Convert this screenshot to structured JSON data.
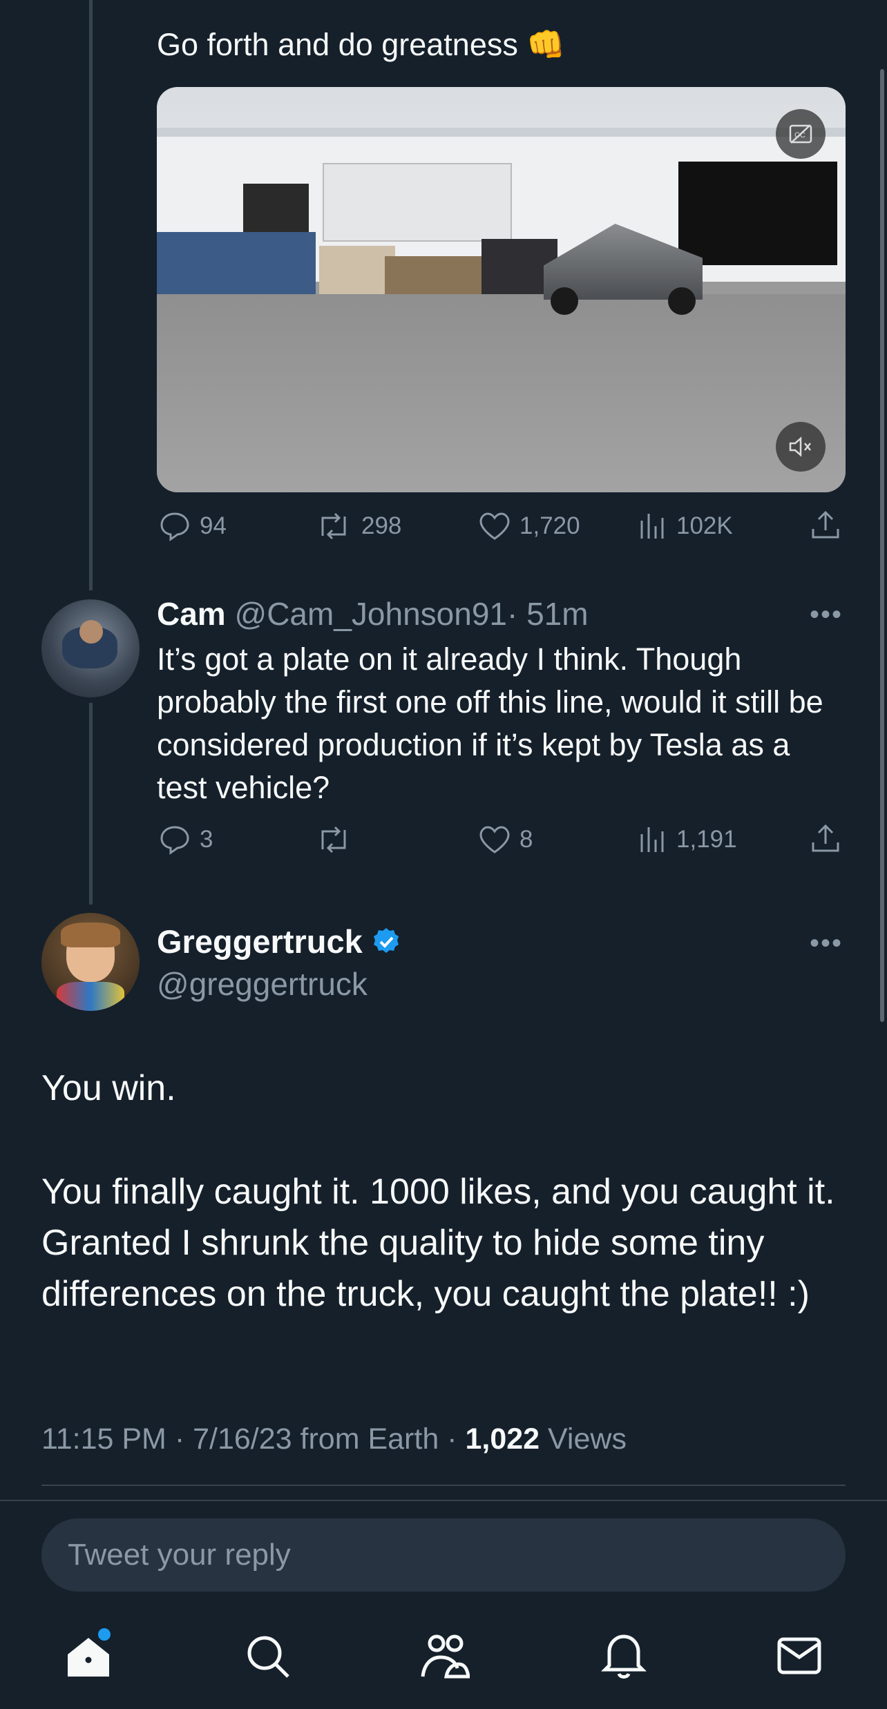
{
  "prev_tweet": {
    "text": "Go forth and do greatness 👊",
    "stats": {
      "replies": "94",
      "retweets": "298",
      "likes": "1,720",
      "views": "102K"
    }
  },
  "reply_tweet": {
    "name": "Cam",
    "handle": "@Cam_Johnson91",
    "time": "· 51m",
    "text": "It’s got a plate on it already I think. Though probably the first one off this line, would it still be considered production if it’s kept by Tesla as a test vehicle?",
    "stats": {
      "replies": "3",
      "retweets": "",
      "likes": "8",
      "views": "1,191"
    }
  },
  "main_tweet": {
    "name": "Greggertruck",
    "handle": "@greggertruck",
    "verified": true,
    "paragraph1": "You win.",
    "paragraph2": "You finally caught it. 1000 likes, and you caught it. Granted I shrunk the quality to hide some tiny differences on the truck, you caught the plate!! :)",
    "time": "11:15 PM",
    "date": "7/16/23 from Earth",
    "views_count": "1,022",
    "views_label": "Views"
  },
  "reply_input": {
    "placeholder": "Tweet your reply"
  },
  "bottom_nav": [
    "home-icon",
    "search-icon",
    "communities-icon",
    "notifications-icon",
    "messages-icon"
  ],
  "colors": {
    "background": "#15202b",
    "muted": "#8b98a5",
    "accent": "#1d9bf0"
  }
}
